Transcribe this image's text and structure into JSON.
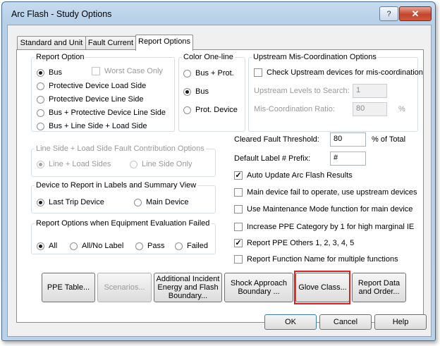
{
  "window": {
    "title": "Arc Flash - Study Options",
    "help_icon": "?",
    "close_icon": "✕"
  },
  "tabs": [
    "Standard and Unit",
    "Fault Current",
    "Report Options"
  ],
  "report_option": {
    "legend": "Report Option",
    "items": [
      "Bus",
      "Protective Device Load Side",
      "Protective Device Line Side",
      "Bus + Protective Device Line Side",
      "Bus + Line Side + Load Side"
    ],
    "selected": "Bus",
    "worst_case_only": "Worst Case Only"
  },
  "color_oneline": {
    "legend": "Color One-line",
    "items": [
      "Bus + Prot.",
      "Bus",
      "Prot. Device"
    ],
    "selected": "Bus"
  },
  "upstream": {
    "legend": "Upstream Mis-Coordination Options",
    "check_label": "Check Upstream devices for mis-coordination",
    "levels_label": "Upstream Levels to Search:",
    "levels_value": "1",
    "ratio_label": "Mis-Coordination Ratio:",
    "ratio_value": "80",
    "ratio_unit": "%"
  },
  "fault_contribution": {
    "legend": "Line Side + Load Side Fault Contribution Options",
    "items": [
      "Line + Load Sides",
      "Line Side Only"
    ],
    "selected": "Line + Load Sides"
  },
  "device_report": {
    "legend": "Device to Report in Labels and Summary View",
    "items": [
      "Last Trip Device",
      "Main Device"
    ],
    "selected": "Last Trip Device"
  },
  "equipment_failed": {
    "legend": "Report Options when Equipment Evaluation Failed",
    "items": [
      "All",
      "All/No Label",
      "Pass",
      "Failed"
    ],
    "selected": "All"
  },
  "cleared_fault": {
    "label": "Cleared Fault Threshold:",
    "value": "80",
    "unit": "% of Total"
  },
  "default_label": {
    "label": "Default Label # Prefix:",
    "value": "#"
  },
  "checks": [
    {
      "label": "Auto Update Arc Flash Results",
      "checked": true
    },
    {
      "label": "Main device fail to operate, use upstream devices",
      "checked": false
    },
    {
      "label": "Use Maintenance Mode function for main device",
      "checked": false
    },
    {
      "label": "Increase PPE Category by 1 for high marginal IE",
      "checked": false
    },
    {
      "label": "Report PPE Others 1, 2, 3, 4, 5",
      "checked": true
    },
    {
      "label": "Report Function Name for multiple functions",
      "checked": false
    }
  ],
  "buttons": {
    "ppe_table": "PPE Table...",
    "scenarios": "Scenarios...",
    "incident_energy": "Additional Incident Energy and Flash Boundary...",
    "shock_approach": "Shock Approach Boundary ...",
    "glove_class": "Glove Class...",
    "report_data": "Report Data and Order..."
  },
  "footer": {
    "ok": "OK",
    "cancel": "Cancel",
    "help": "Help"
  },
  "colors": {
    "highlight": "#e02020",
    "title_bar": "#b9d1e9"
  }
}
